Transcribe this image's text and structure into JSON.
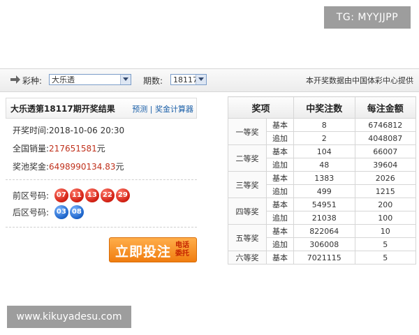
{
  "watermark_top": "TG: MYYJJPP",
  "watermark_bottom": "www.kikuyadesu.com",
  "topbar": {
    "lottery_label": "彩种:",
    "lottery_value": "大乐透",
    "issue_label": "期数:",
    "issue_value": "18117",
    "notice": "本开奖数据由中国体彩中心提供"
  },
  "result": {
    "title": "大乐透第18117期开奖结果",
    "links": "预测 | 奖金计算器",
    "draw_time_label": "开奖时间:",
    "draw_time": "2018-10-06 20:30",
    "sales_label": "全国销量:",
    "sales_value": "217651581",
    "sales_unit": "元",
    "pool_label": "奖池奖金:",
    "pool_value": "6498990134.83",
    "pool_unit": "元",
    "front_label": "前区号码:",
    "front_numbers": [
      "07",
      "11",
      "13",
      "22",
      "29"
    ],
    "back_label": "后区号码:",
    "back_numbers": [
      "03",
      "08"
    ]
  },
  "buy_button": {
    "label": "立即投注",
    "sub": "电话委托"
  },
  "prize_table": {
    "headers": [
      "奖项",
      "中奖注数",
      "每注金额"
    ],
    "rows": [
      {
        "level": "一等奖",
        "type": "基本",
        "count": "8",
        "amount": "6746812"
      },
      {
        "level": "",
        "type": "追加",
        "count": "2",
        "amount": "4048087"
      },
      {
        "level": "二等奖",
        "type": "基本",
        "count": "104",
        "amount": "66007"
      },
      {
        "level": "",
        "type": "追加",
        "count": "48",
        "amount": "39604"
      },
      {
        "level": "三等奖",
        "type": "基本",
        "count": "1383",
        "amount": "2026"
      },
      {
        "level": "",
        "type": "追加",
        "count": "499",
        "amount": "1215"
      },
      {
        "level": "四等奖",
        "type": "基本",
        "count": "54951",
        "amount": "200"
      },
      {
        "level": "",
        "type": "追加",
        "count": "21038",
        "amount": "100"
      },
      {
        "level": "五等奖",
        "type": "基本",
        "count": "822064",
        "amount": "10"
      },
      {
        "level": "",
        "type": "追加",
        "count": "306008",
        "amount": "5"
      },
      {
        "level": "六等奖",
        "type": "基本",
        "count": "7021115",
        "amount": "5"
      }
    ]
  }
}
